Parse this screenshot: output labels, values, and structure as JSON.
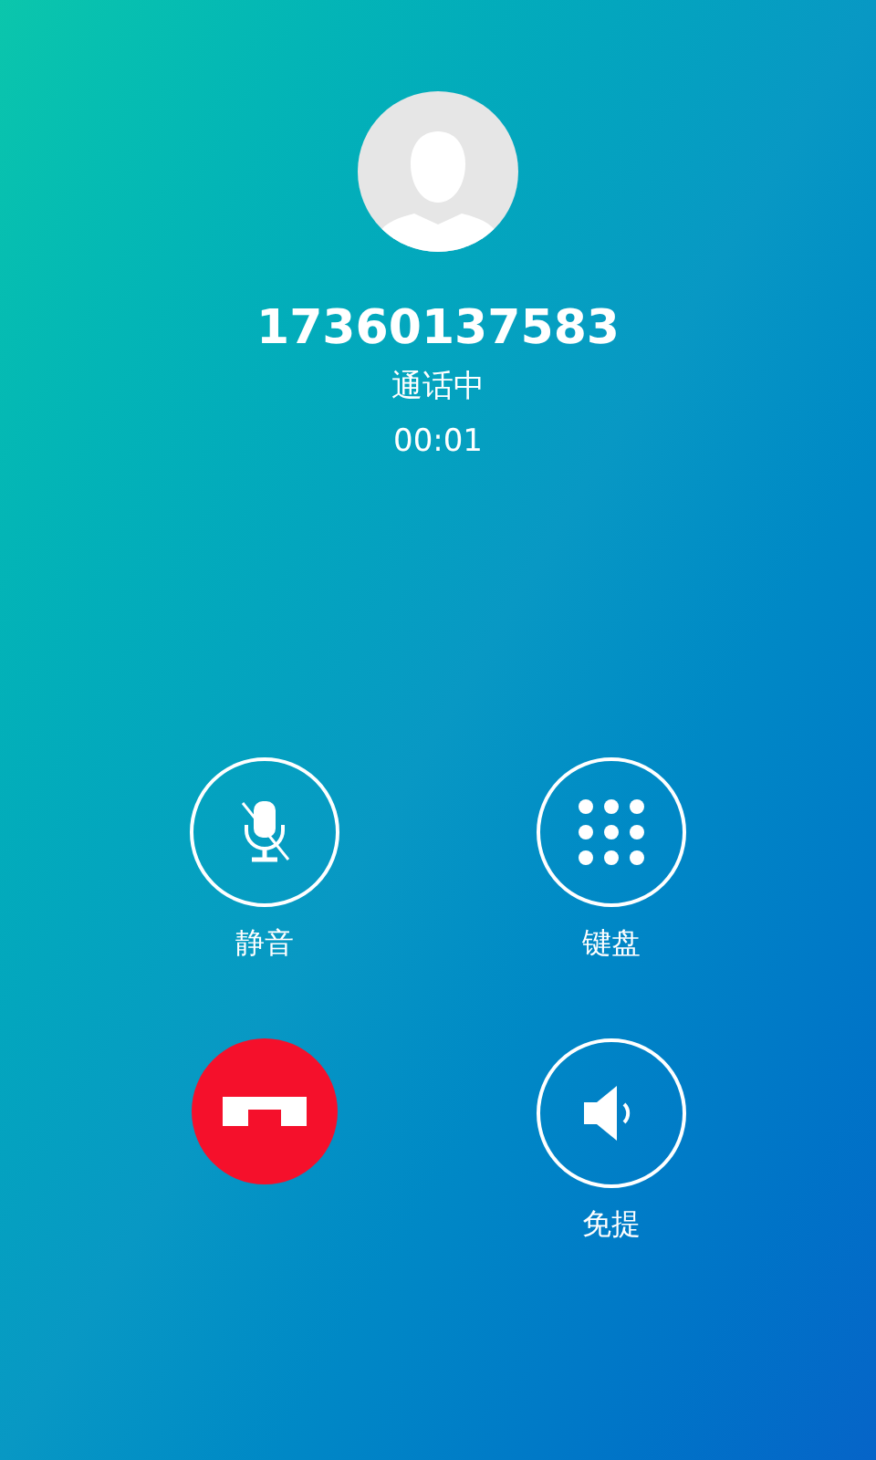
{
  "caller": {
    "number": "17360137583",
    "status": "通话中",
    "duration": "00:01"
  },
  "controls": [
    {
      "kind": "mute",
      "label": "静音"
    },
    {
      "kind": "keypad",
      "label": "键盘"
    },
    {
      "kind": "hangup"
    },
    {
      "kind": "speaker",
      "label": "免提"
    }
  ]
}
